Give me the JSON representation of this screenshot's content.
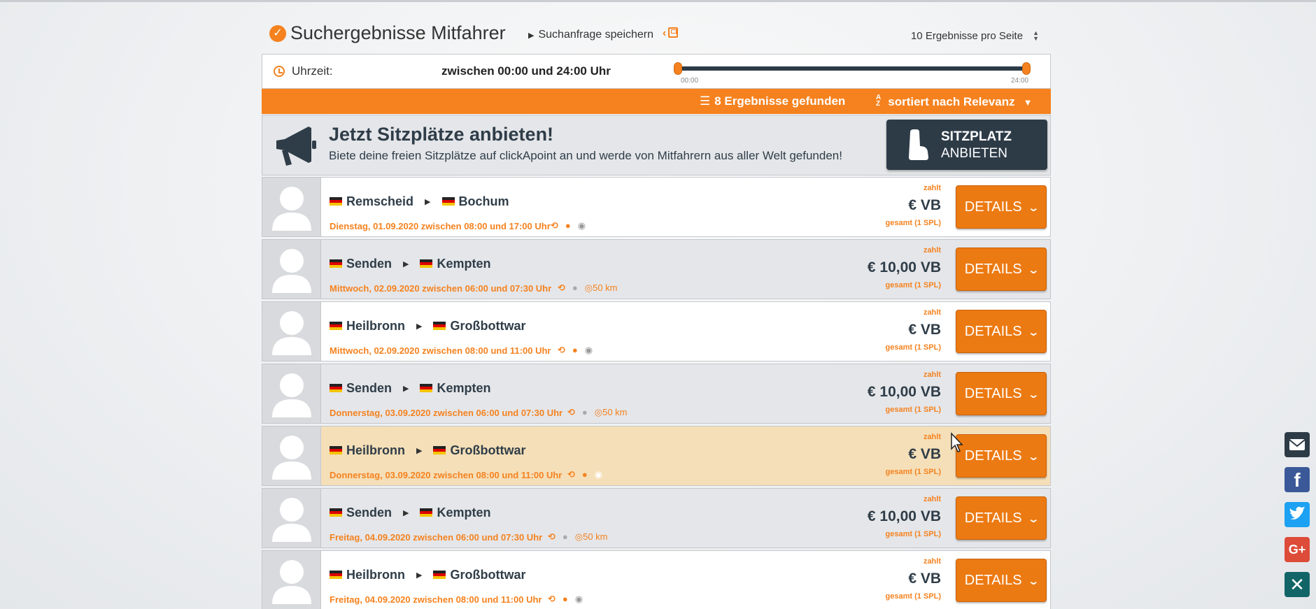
{
  "header": {
    "title": "Suchergebnisse Mitfahrer",
    "save_search": "Suchanfrage speichern",
    "per_page": "10 Ergebnisse pro Seite"
  },
  "time_filter": {
    "label": "Uhrzeit:",
    "range_text": "zwischen 00:00 und 24:00 Uhr",
    "slider_min": "00:00",
    "slider_max": "24:00"
  },
  "results_bar": {
    "count": "8 Ergebnisse gefunden",
    "sort": "sortiert nach Relevanz"
  },
  "promo": {
    "title": "Jetzt Sitzplätze anbieten!",
    "text": "Biete deine freien Sitzplätze auf clickApoint an und werde von Mitfahrern aus aller Welt gefunden!",
    "button_line1": "SITZPLATZ",
    "button_line2": "ANBIETEN"
  },
  "labels": {
    "pays": "zahlt",
    "total": "gesamt (1 SPL)",
    "details": "DETAILS"
  },
  "rides": [
    {
      "from": "Remscheid",
      "to": "Bochum",
      "date": "Dienstag, 01.09.2020 zwischen 08:00 und 17:00 Uhr",
      "price": "€ VB",
      "km": ""
    },
    {
      "from": "Senden",
      "to": "Kempten",
      "date": "Mittwoch, 02.09.2020 zwischen 06:00 und 07:30 Uhr",
      "price": "€ 10,00 VB",
      "km": "50 km"
    },
    {
      "from": "Heilbronn",
      "to": "Großbottwar",
      "date": "Mittwoch, 02.09.2020 zwischen 08:00 und 11:00 Uhr",
      "price": "€ VB",
      "km": ""
    },
    {
      "from": "Senden",
      "to": "Kempten",
      "date": "Donnerstag, 03.09.2020 zwischen 06:00 und 07:30 Uhr",
      "price": "€ 10,00 VB",
      "km": "50 km"
    },
    {
      "from": "Heilbronn",
      "to": "Großbottwar",
      "date": "Donnerstag, 03.09.2020 zwischen 08:00 und 11:00 Uhr",
      "price": "€ VB",
      "km": ""
    },
    {
      "from": "Senden",
      "to": "Kempten",
      "date": "Freitag, 04.09.2020 zwischen 06:00 und 07:30 Uhr",
      "price": "€ 10,00 VB",
      "km": "50 km"
    },
    {
      "from": "Heilbronn",
      "to": "Großbottwar",
      "date": "Freitag, 04.09.2020 zwischen 08:00 und 11:00 Uhr",
      "price": "€ VB",
      "km": ""
    }
  ],
  "colors": {
    "accent": "#f5821f",
    "dark": "#2d3b47",
    "highlight_row": "#f5dfb8"
  },
  "social": [
    "mail-icon",
    "facebook-icon",
    "twitter-icon",
    "google-plus-icon",
    "xing-icon"
  ]
}
